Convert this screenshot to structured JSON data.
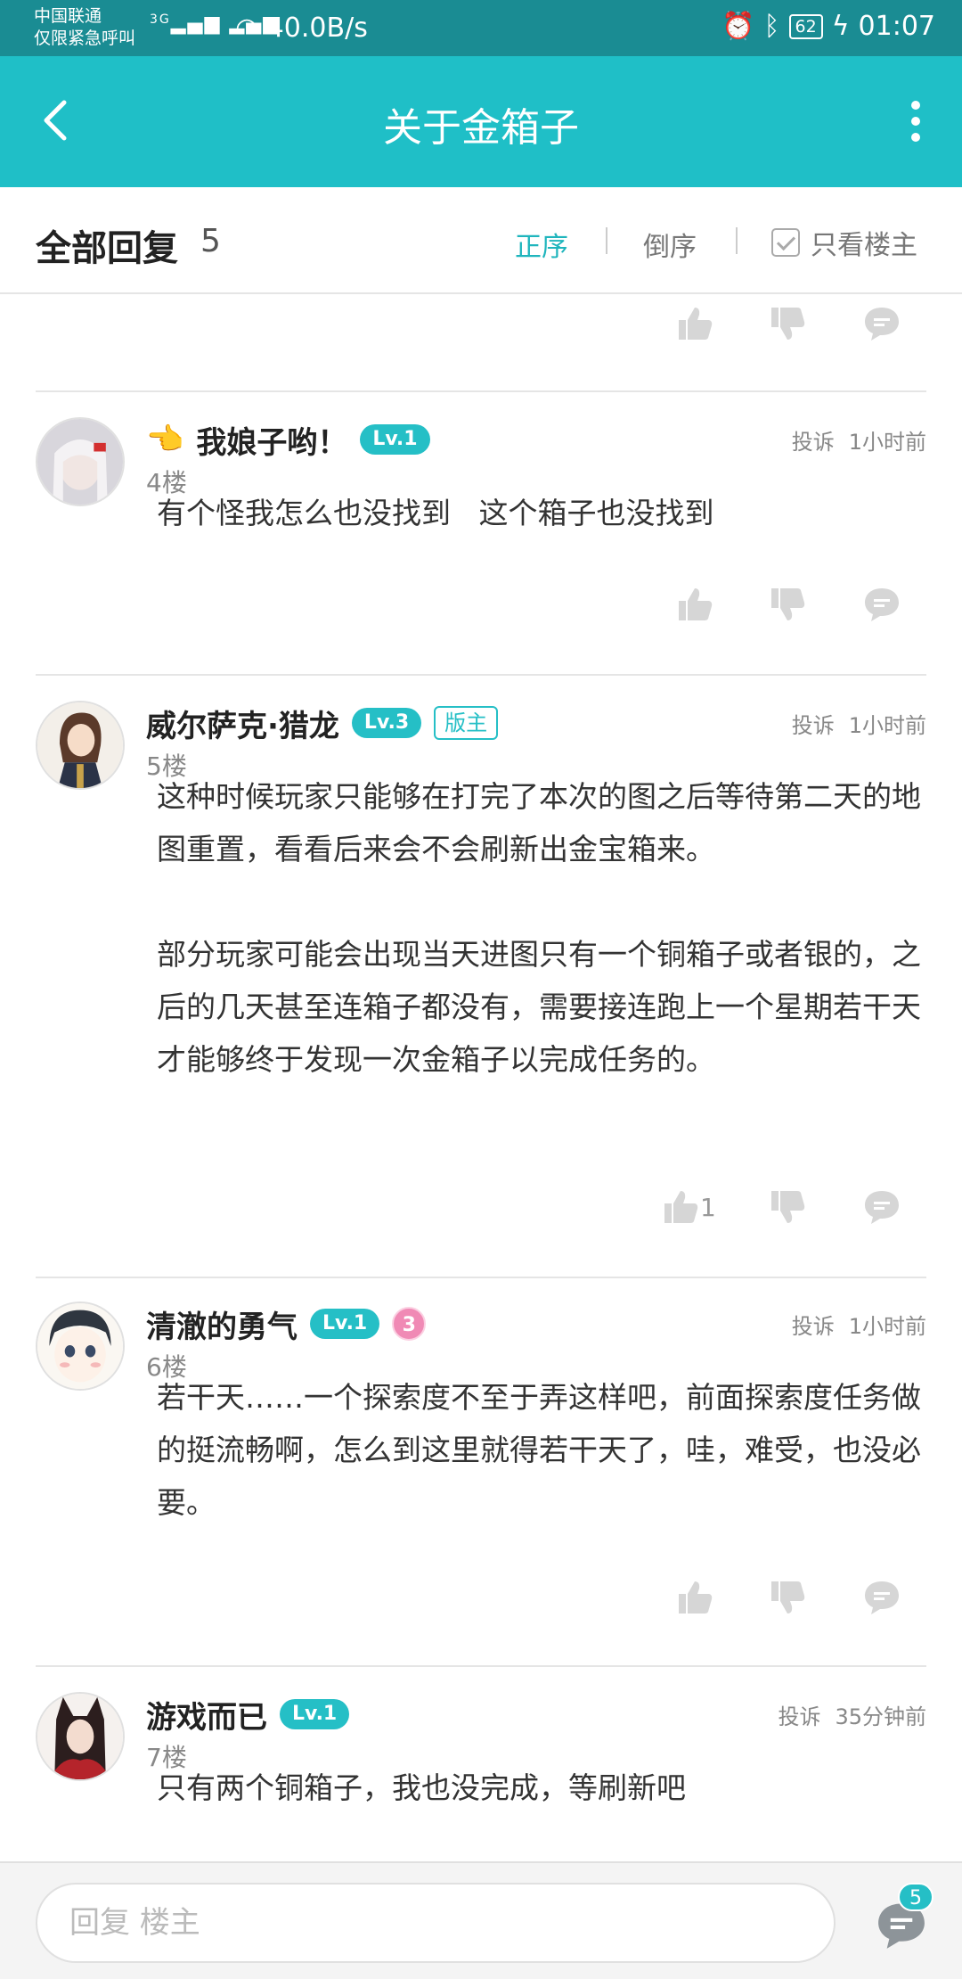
{
  "status_bar": {
    "carrier_line1": "中国联通",
    "carrier_line2": "仅限紧急呼叫",
    "network": "3G",
    "speed": "40.0B/s",
    "battery": "62",
    "time": "01:07"
  },
  "header": {
    "title": "关于金箱子"
  },
  "filter": {
    "all_replies_label": "全部回复",
    "count": "5",
    "sort_asc": "正序",
    "sort_desc": "倒序",
    "only_host": "只看楼主",
    "accent": "#1fbfc7"
  },
  "posts": [
    {
      "emoji": "👈",
      "username": "我娘子哟！",
      "level": "Lv.1",
      "report": "投诉",
      "time": "1小时前",
      "floor": "4楼",
      "paragraphs": [
        "有个怪我怎么也没找到   这个箱子也没找到"
      ]
    },
    {
      "username": "威尔萨克·猎龙",
      "level": "Lv.3",
      "badge": "版主",
      "report": "投诉",
      "time": "1小时前",
      "floor": "5楼",
      "paragraphs": [
        "这种时候玩家只能够在打完了本次的图之后等待第二天的地图重置，看看后来会不会刷新出金宝箱来。",
        "部分玩家可能会出现当天进图只有一个铜箱子或者银的，之后的几天甚至连箱子都没有，需要接连跑上一个星期若干天才能够终于发现一次金箱子以完成任务的。"
      ],
      "likes": "1"
    },
    {
      "username": "清澈的勇气",
      "level": "Lv.1",
      "medal": "3",
      "report": "投诉",
      "time": "1小时前",
      "floor": "6楼",
      "paragraphs": [
        "若干天……一个探索度不至于弄这样吧，前面探索度任务做的挺流畅啊，怎么到这里就得若干天了，哇，难受，也没必要。"
      ]
    },
    {
      "username": "游戏而已",
      "level": "Lv.1",
      "report": "投诉",
      "time": "35分钟前",
      "floor": "7楼",
      "paragraphs": [
        "只有两个铜箱子，我也没完成，等刷新吧"
      ]
    }
  ],
  "bottom": {
    "reply_placeholder": "回复  楼主",
    "comment_count": "5"
  }
}
